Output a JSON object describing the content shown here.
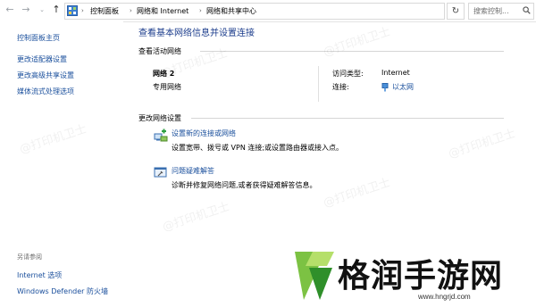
{
  "address_bar": {
    "breadcrumbs": [
      "控制面板",
      "网络和 Internet",
      "网络和共享中心"
    ],
    "search_placeholder": "搜索控制..."
  },
  "sidebar": {
    "items": [
      {
        "label": "控制面板主页"
      },
      {
        "label": "更改适配器设置"
      },
      {
        "label": "更改高级共享设置"
      },
      {
        "label": "媒体流式处理选项"
      }
    ],
    "see_also_label": "另请参阅",
    "see_also": [
      {
        "label": "Internet 选项"
      },
      {
        "label": "Windows Defender 防火墙"
      }
    ]
  },
  "main": {
    "title": "查看基本网络信息并设置连接",
    "active_networks_label": "查看活动网络",
    "network": {
      "name": "网络 2",
      "category": "专用网络",
      "access_type_label": "访问类型:",
      "access_type_value": "Internet",
      "connections_label": "连接:",
      "connection_value": "以太网"
    },
    "change_settings_label": "更改网络设置",
    "tasks": [
      {
        "title": "设置新的连接或网络",
        "description": "设置宽带、拨号或 VPN 连接;或设置路由器或接入点。"
      },
      {
        "title": "问题疑难解答",
        "description": "诊断并修复网络问题,或者获得疑难解答信息。"
      }
    ]
  },
  "watermark": "@打印机卫士",
  "site_logo": {
    "text": "格润手游网",
    "url": "www.hngrjd.com"
  }
}
